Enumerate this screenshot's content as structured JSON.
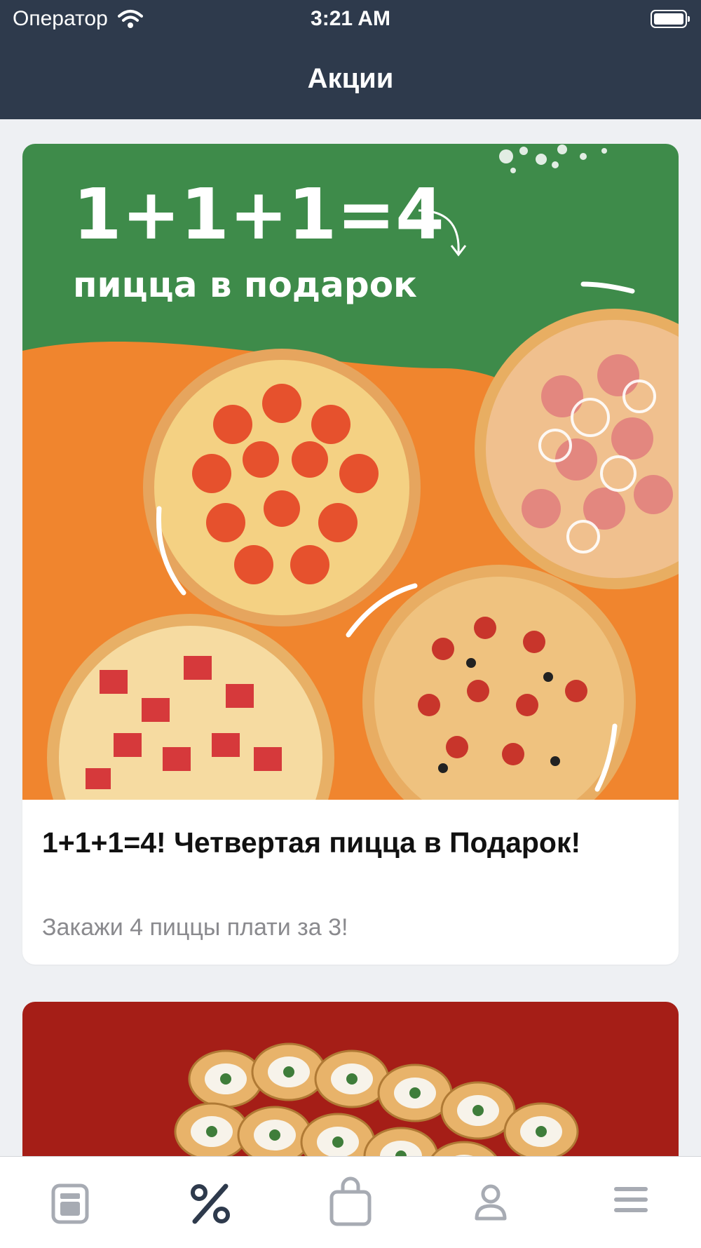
{
  "status_bar": {
    "carrier": "Оператор",
    "time": "3:21 AM",
    "battery_level": 1.0
  },
  "header": {
    "title": "Акции"
  },
  "promos": [
    {
      "banner": {
        "headline": "1+1+1=4",
        "subheadline": "пицца в подарок"
      },
      "title": "1+1+1=4! Четвертая пицца в Подарок!",
      "subtitle": "Закажи 4 пиццы плати за 3!"
    },
    {
      "banner_color": "#a51e17"
    }
  ],
  "tabbar": {
    "tabs": [
      {
        "icon": "menu-card-icon",
        "active": false
      },
      {
        "icon": "percent-icon",
        "active": true
      },
      {
        "icon": "shopping-bag-icon",
        "active": false
      },
      {
        "icon": "profile-icon",
        "active": false
      },
      {
        "icon": "hamburger-menu-icon",
        "active": false
      }
    ]
  },
  "colors": {
    "header_bg": "#2e3a4c",
    "banner_green": "#3e8b4a",
    "banner_orange": "#f0852e",
    "inactive_icon": "#a7abb3",
    "active_icon": "#2e3a4c"
  }
}
